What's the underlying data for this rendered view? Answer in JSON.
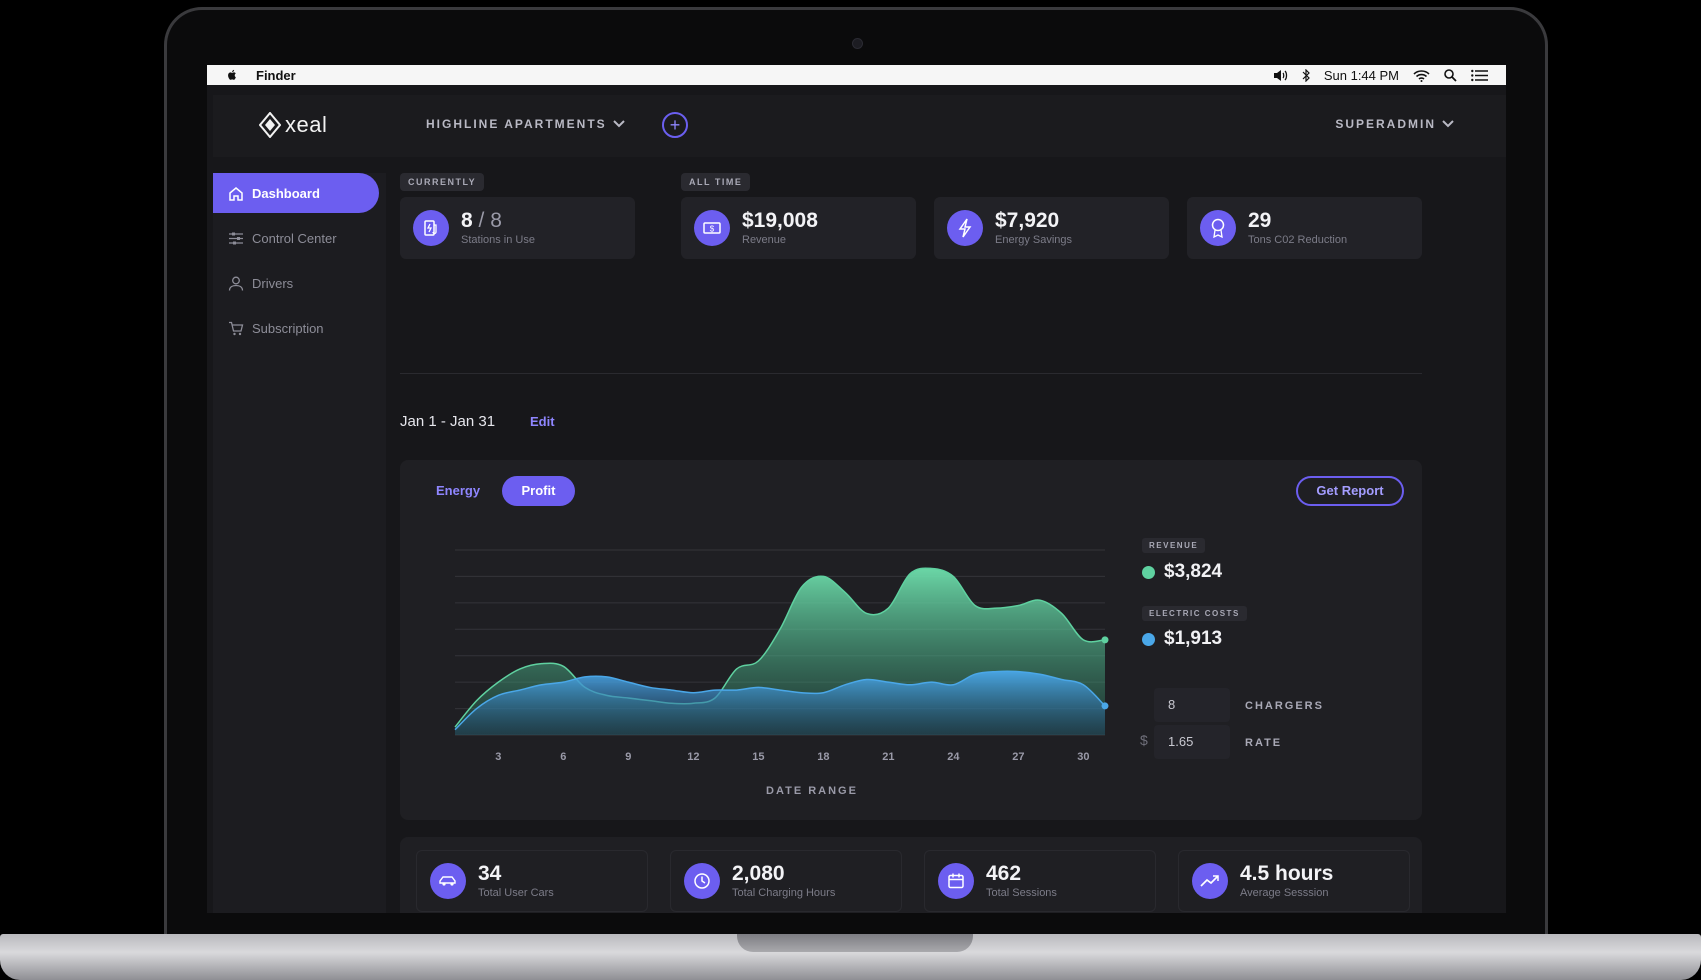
{
  "menubar": {
    "app_name": "Finder",
    "clock": "Sun 1:44 PM",
    "icons": [
      "apple-icon",
      "volume-icon",
      "bluetooth-icon",
      "wifi-icon",
      "spotlight-search-icon",
      "notification-list-icon"
    ]
  },
  "header": {
    "logo_text": "xeal",
    "property_name": "HIGHLINE APARTMENTS",
    "add_label": "+",
    "user_role": "SUPERADMIN"
  },
  "sidebar": {
    "items": [
      {
        "label": "Dashboard",
        "icon": "home-icon",
        "active": true
      },
      {
        "label": "Control Center",
        "icon": "sliders-icon",
        "active": false
      },
      {
        "label": "Drivers",
        "icon": "user-icon",
        "active": false
      },
      {
        "label": "Subscription",
        "icon": "cart-icon",
        "active": false
      }
    ]
  },
  "summary": {
    "currently_tag": "CURRENTLY",
    "all_time_tag": "ALL TIME",
    "stations_in_use": {
      "value": "8",
      "total": "8",
      "separator": "/",
      "label": "Stations in Use",
      "icon": "charging-station-icon"
    },
    "revenue": {
      "value": "$19,008",
      "label": "Revenue",
      "icon": "money-icon"
    },
    "energy_savings": {
      "value": "$7,920",
      "label": "Energy Savings",
      "icon": "lightning-icon"
    },
    "co2_reduction": {
      "value": "29",
      "label": "Tons C02 Reduction",
      "icon": "award-icon"
    }
  },
  "date_filter": {
    "range": "Jan 1 - Jan 31",
    "edit_label": "Edit"
  },
  "chart_panel": {
    "tabs": [
      "Energy",
      "Profit"
    ],
    "active_tab": "Profit",
    "report_button": "Get Report",
    "legend": {
      "revenue_tag": "REVENUE",
      "revenue_value": "$3,824",
      "revenue_color": "#5fd1a0",
      "costs_tag": "ELECTRIC COSTS",
      "costs_value": "$1,913",
      "costs_color": "#4aa7e8"
    },
    "chargers": {
      "value": "8",
      "label": "CHARGERS"
    },
    "rate": {
      "currency": "$",
      "value": "1.65",
      "label": "RATE"
    }
  },
  "chart_data": {
    "type": "area",
    "xlabel": "DATE RANGE",
    "ylabel": "",
    "x_ticks": [
      3,
      6,
      9,
      12,
      15,
      18,
      21,
      24,
      27,
      30
    ],
    "xlim": [
      1,
      31
    ],
    "ylim": [
      0,
      7
    ],
    "grid": true,
    "series": [
      {
        "name": "REVENUE",
        "color": "#5fd1a0",
        "x": [
          1,
          2,
          3,
          4,
          5,
          6,
          7,
          8,
          9,
          10,
          11,
          12,
          13,
          14,
          15,
          16,
          17,
          18,
          19,
          20,
          21,
          22,
          23,
          24,
          25,
          26,
          27,
          28,
          29,
          30,
          31
        ],
        "values": [
          0.3,
          1.3,
          2.0,
          2.5,
          2.7,
          2.6,
          1.8,
          1.5,
          1.4,
          1.3,
          1.2,
          1.2,
          1.4,
          2.5,
          2.8,
          4.0,
          5.6,
          6.0,
          5.4,
          4.6,
          4.8,
          6.1,
          6.3,
          6.0,
          4.9,
          4.8,
          4.9,
          5.1,
          4.6,
          3.6,
          3.6
        ]
      },
      {
        "name": "ELECTRIC COSTS",
        "color": "#4aa7e8",
        "x": [
          1,
          2,
          3,
          4,
          5,
          6,
          7,
          8,
          9,
          10,
          11,
          12,
          13,
          14,
          15,
          16,
          17,
          18,
          19,
          20,
          21,
          22,
          23,
          24,
          25,
          26,
          27,
          28,
          29,
          30,
          31
        ],
        "values": [
          0.2,
          1.0,
          1.5,
          1.7,
          1.9,
          2.0,
          2.2,
          2.2,
          2.0,
          1.8,
          1.7,
          1.6,
          1.7,
          1.7,
          1.8,
          1.7,
          1.6,
          1.6,
          1.9,
          2.1,
          2.0,
          1.9,
          2.0,
          1.9,
          2.3,
          2.4,
          2.4,
          2.3,
          2.1,
          1.9,
          1.1
        ]
      }
    ]
  },
  "bottom_stats": [
    {
      "value": "34",
      "label": "Total User Cars",
      "icon": "car-icon"
    },
    {
      "value": "2,080",
      "label": "Total Charging Hours",
      "icon": "clock-icon"
    },
    {
      "value": "462",
      "label": "Total Sessions",
      "icon": "calendar-icon"
    },
    {
      "value": "4.5 hours",
      "label": "Average Sesssion",
      "icon": "trend-icon"
    }
  ]
}
